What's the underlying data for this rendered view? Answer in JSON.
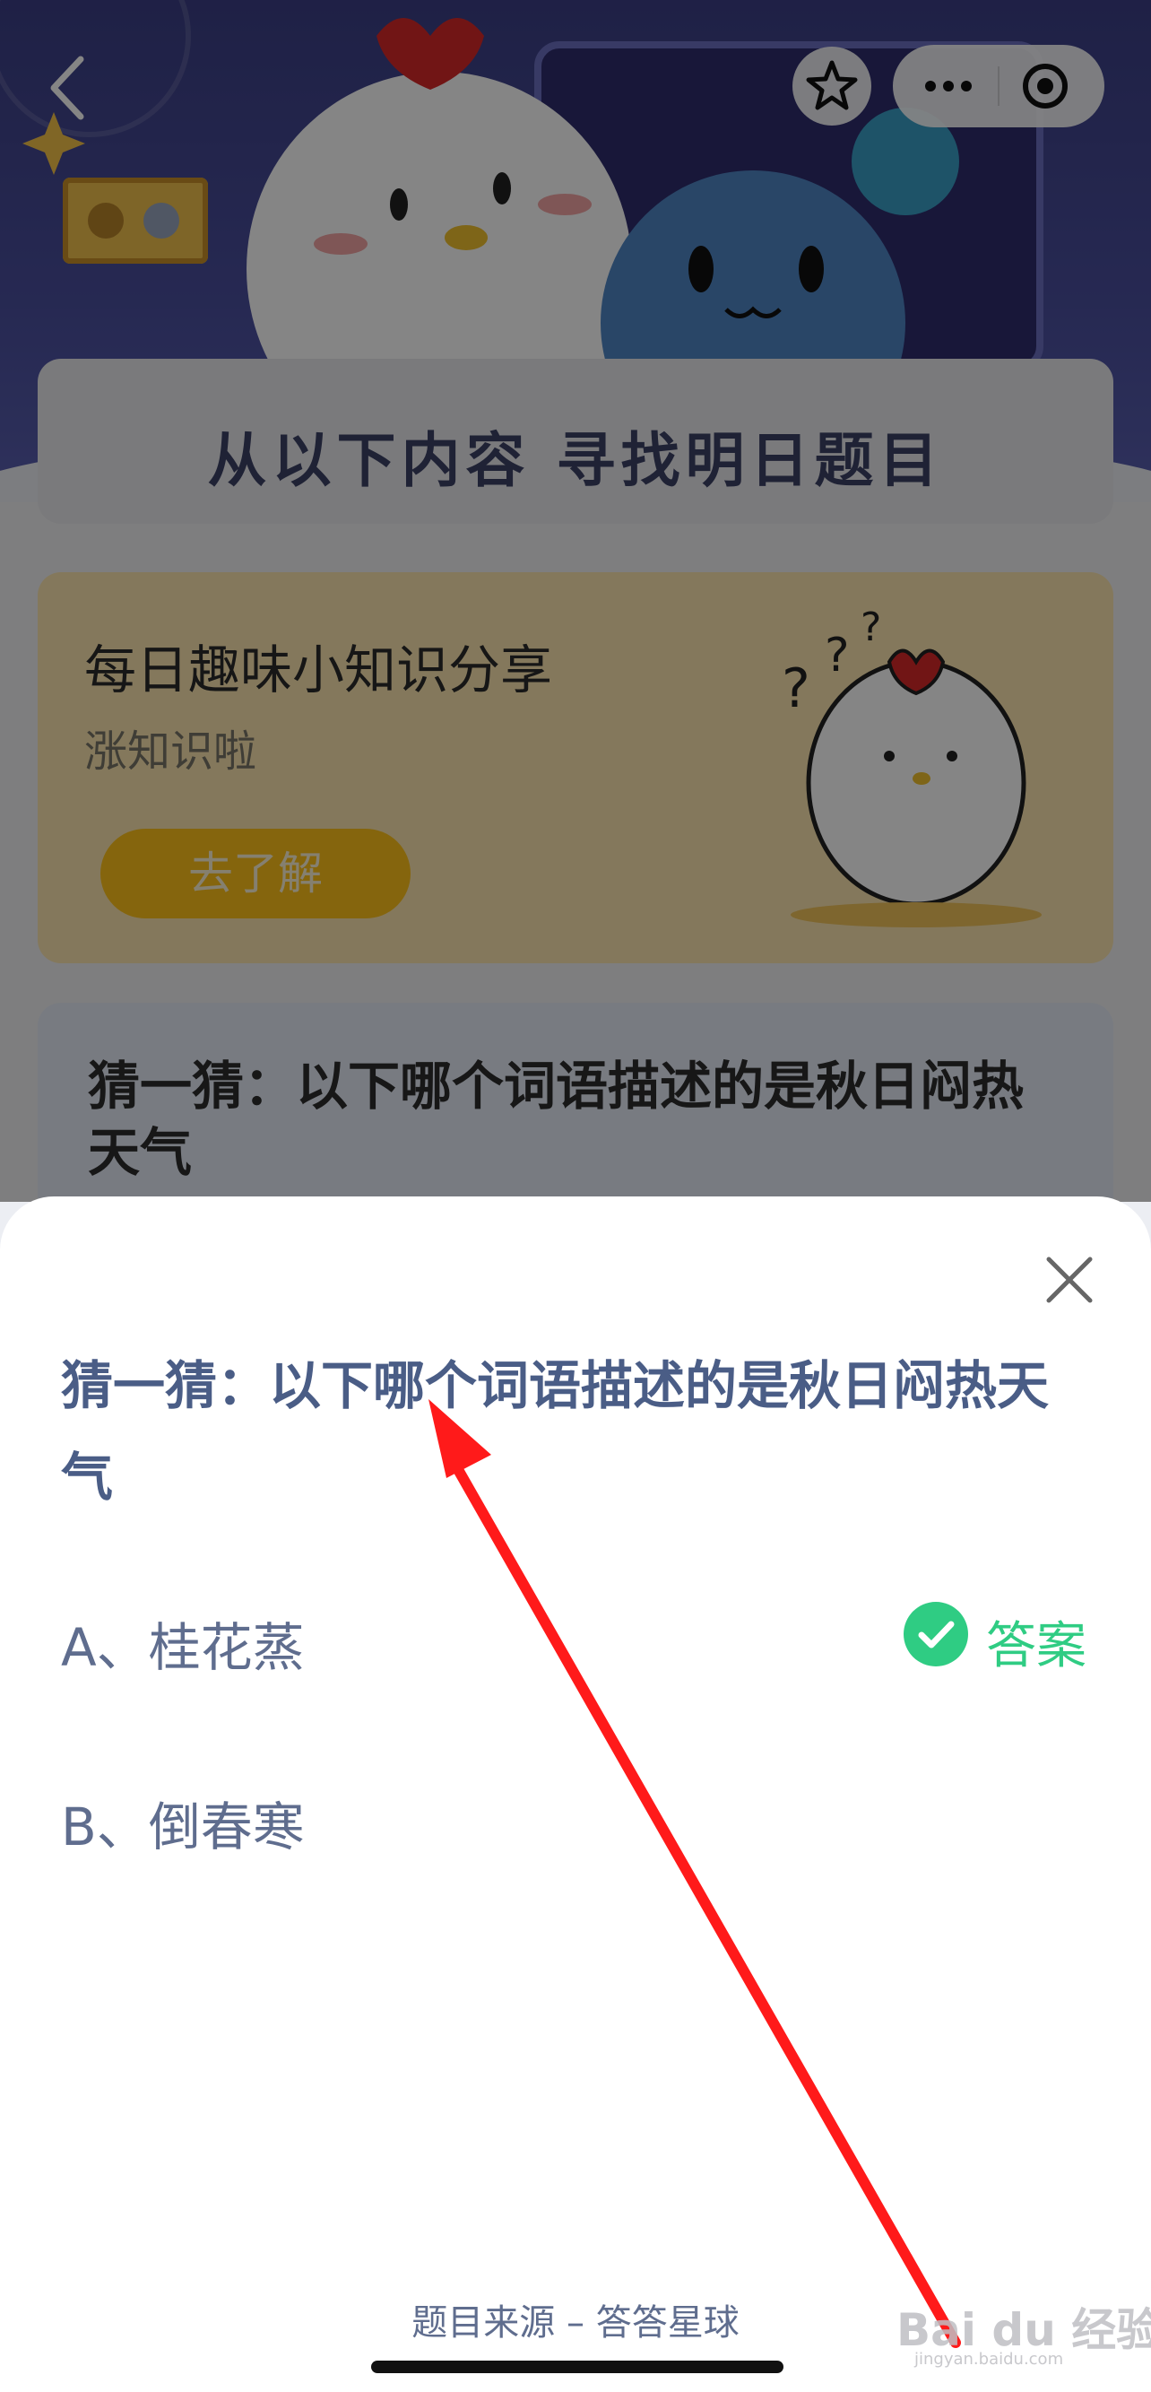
{
  "header": {
    "back_icon": "chevron-left-icon",
    "favorite_icon": "star-icon",
    "more_icon": "more-dots-icon",
    "close_target_icon": "target-circle-icon"
  },
  "page": {
    "banner_text": "从以下内容  寻找明日题目",
    "card_knowledge": {
      "title": "每日趣味小知识分享",
      "subtitle": "涨知识啦",
      "button": "去了解"
    },
    "card_guess": {
      "text": "猜一猜：以下哪个词语描述的是秋日闷热天气"
    }
  },
  "sheet": {
    "close_icon": "close-icon",
    "question": "猜一猜：以下哪个词语描述的是秋日闷热天气",
    "options": [
      {
        "label": "A、桂花蒸",
        "is_answer": true
      },
      {
        "label": "B、倒春寒",
        "is_answer": false
      }
    ],
    "answer_label": "答案",
    "source": "题目来源 – 答答星球"
  },
  "watermark": {
    "text": "Bai du 经验",
    "sub": "jingyan.baidu.com"
  },
  "colors": {
    "accent_green": "#2fcc83",
    "question_blue": "#4a5d86",
    "annotation_red": "#ff1a1a"
  }
}
